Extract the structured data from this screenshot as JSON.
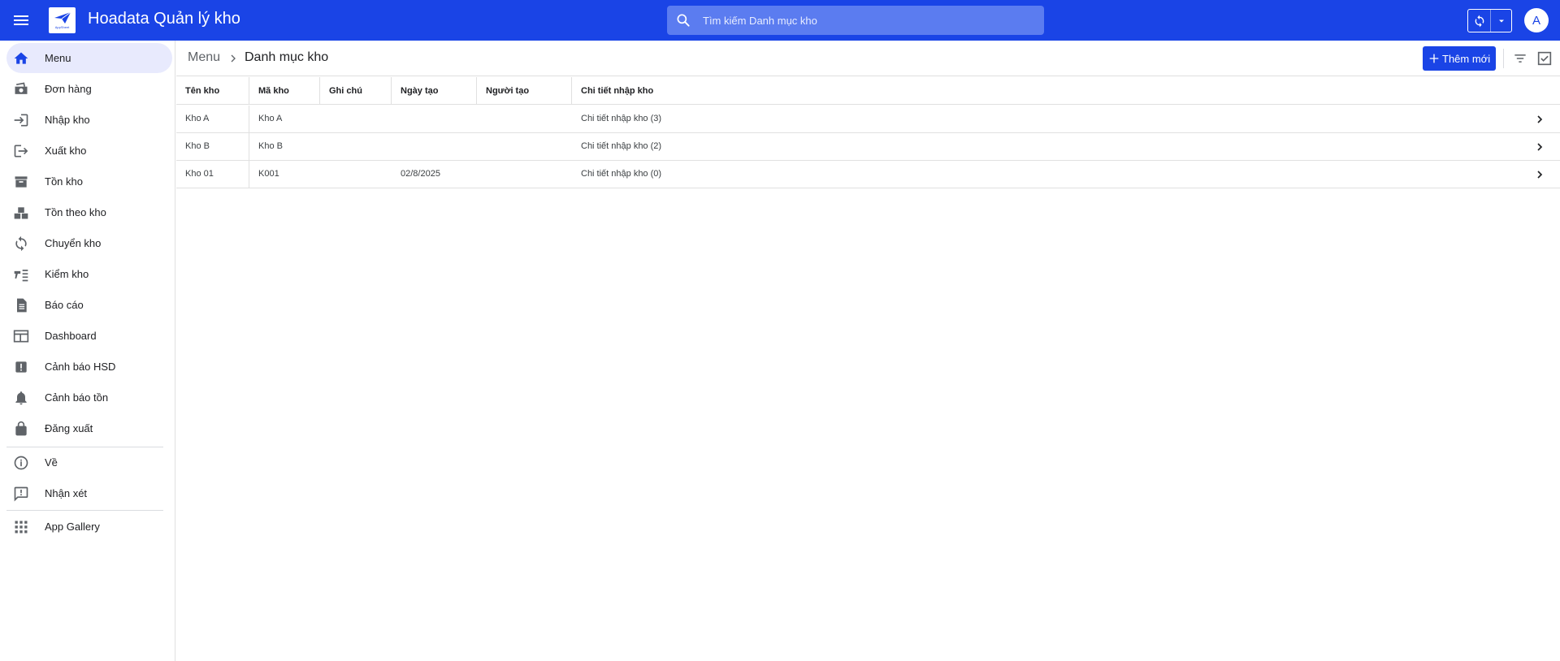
{
  "app": {
    "title": "Hoadata Quản lý kho",
    "logo_text": "AppSheet"
  },
  "search": {
    "placeholder": "Tìm kiếm Danh mục kho"
  },
  "user": {
    "avatar_letter": "A"
  },
  "sidebar": {
    "items": [
      {
        "label": "Menu",
        "icon": "home-icon"
      },
      {
        "label": "Đơn hàng",
        "icon": "money-icon"
      },
      {
        "label": "Nhập kho",
        "icon": "login-icon"
      },
      {
        "label": "Xuất kho",
        "icon": "logout-icon"
      },
      {
        "label": "Tồn kho",
        "icon": "archive-icon"
      },
      {
        "label": "Tồn theo kho",
        "icon": "boxes-icon"
      },
      {
        "label": "Chuyển kho",
        "icon": "sync-icon"
      },
      {
        "label": "Kiểm kho",
        "icon": "checklist-icon"
      },
      {
        "label": "Báo cáo",
        "icon": "report-icon"
      },
      {
        "label": "Dashboard",
        "icon": "dashboard-icon"
      },
      {
        "label": "Cảnh báo HSD",
        "icon": "alert-icon"
      },
      {
        "label": "Cảnh báo tồn",
        "icon": "bell-icon"
      },
      {
        "label": "Đăng xuất",
        "icon": "lock-icon"
      }
    ],
    "about_label": "Về",
    "feedback_label": "Nhận xét",
    "gallery_label": "App Gallery"
  },
  "breadcrumb": {
    "root": "Menu",
    "current": "Danh mục kho"
  },
  "toolbar": {
    "add_label": "Thêm mới"
  },
  "table": {
    "columns": [
      "Tên kho",
      "Mã kho",
      "Ghi chú",
      "Ngày tạo",
      "Người tạo",
      "Chi tiết nhập kho"
    ],
    "rows": [
      [
        "Kho A",
        "Kho A",
        "",
        "",
        "",
        "Chi tiết nhập kho (3)"
      ],
      [
        "Kho B",
        "Kho B",
        "",
        "",
        "",
        "Chi tiết nhập kho (2)"
      ],
      [
        "Kho 01",
        "K001",
        "",
        "02/8/2025",
        "",
        "Chi tiết nhập kho (0)"
      ]
    ]
  },
  "colors": {
    "brand": "#1a44e6",
    "active_bg": "#e8eafd"
  }
}
